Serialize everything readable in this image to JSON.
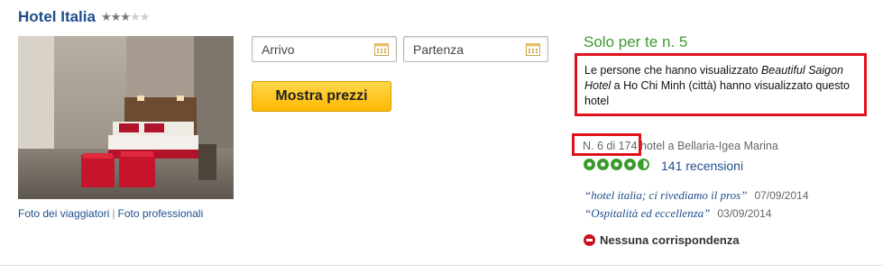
{
  "hotel": {
    "name": "Hotel Italia",
    "star_rating": 3,
    "star_max": 5
  },
  "photo_links": {
    "travelers": "Foto dei viaggiatori",
    "separator": "|",
    "professional": "Foto professionali"
  },
  "booking": {
    "checkin_placeholder": "Arrivo",
    "checkout_placeholder": "Partenza",
    "show_prices_label": "Mostra prezzi",
    "icon": "calendar-icon"
  },
  "recommendation": {
    "heading": "Solo per te n. 5",
    "text_before": "Le persone che hanno visualizzato ",
    "hotel_ref": "Beautiful Saigon Hotel",
    "text_after": " a Ho Chi Minh (città) hanno visualizzato questo hotel"
  },
  "ranking": {
    "rank": "N. 6 di 174",
    "context": " hotel a Bellaria-Igea Marina"
  },
  "rating": {
    "bubbles": 4.5,
    "reviews": "141 recensioni"
  },
  "quotes": [
    {
      "text": "“hotel italia; ci rivediamo il pros”",
      "date": "07/09/2014"
    },
    {
      "text": "“Ospitalità ed eccellenza”",
      "date": "03/09/2014"
    }
  ],
  "availability": {
    "icon": "no-entry-icon",
    "text": "Nessuna corrispondenza"
  },
  "colors": {
    "title_blue": "#1f4e8c",
    "green": "#3b9b2c",
    "highlight_red": "#e0111b",
    "button_yellow": "#ffc000"
  }
}
